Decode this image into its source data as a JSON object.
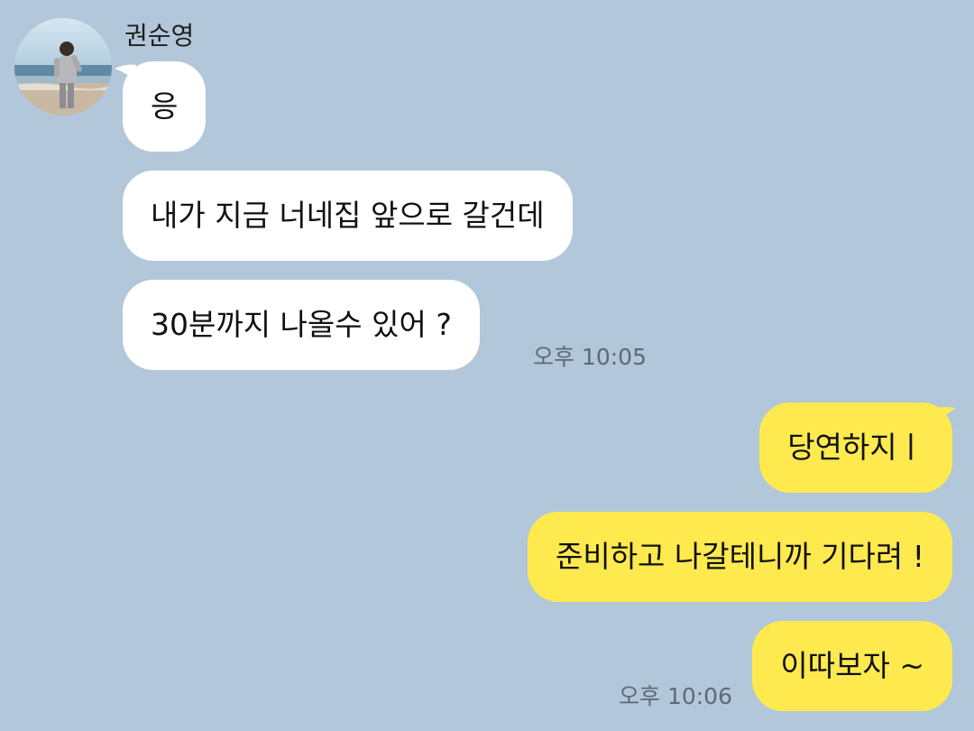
{
  "chat": {
    "sender_name": "권순영",
    "incoming": [
      {
        "text": "응"
      },
      {
        "text": "내가 지금 너네집 앞으로 갈건데"
      },
      {
        "text": "30분까지 나올수 있어 ?"
      }
    ],
    "incoming_time": "오후 10:05",
    "outgoing": [
      {
        "text": "당연하지ㅣ"
      },
      {
        "text": "준비하고 나갈테니까 기다려 !"
      },
      {
        "text": "이따보자 ~"
      }
    ],
    "outgoing_time": "오후 10:06"
  },
  "colors": {
    "background": "#b2c7da",
    "incoming_bubble": "#ffffff",
    "outgoing_bubble": "#fee94f"
  },
  "icons": {
    "avatar": "profile-photo"
  }
}
